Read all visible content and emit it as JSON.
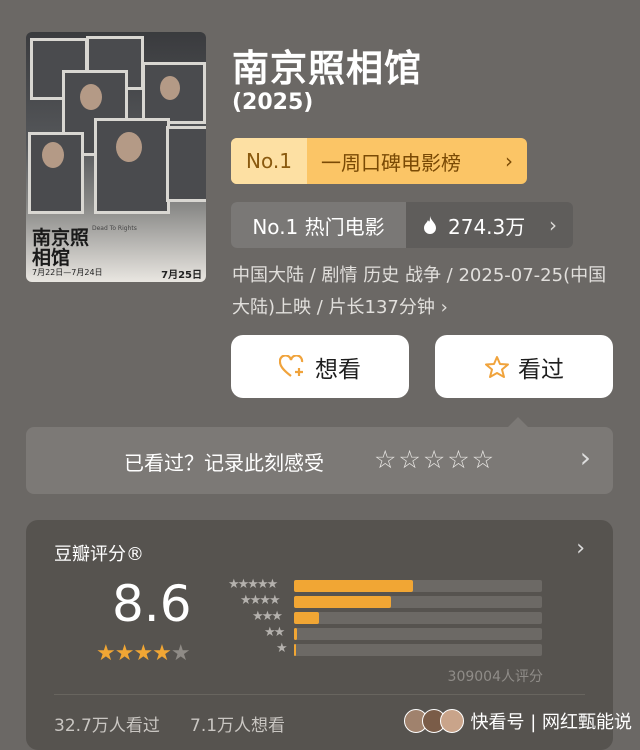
{
  "movie": {
    "title": "南京照相馆",
    "year": "(2025)",
    "poster": {
      "title": "南京照相馆",
      "subtitle": "Dead To Rights",
      "dates": "7月22日—7月24日",
      "release": "7月25日"
    }
  },
  "rank_weekly": {
    "label": "No.1",
    "text": "一周口碑电影榜",
    "chevron": "›"
  },
  "rank_hot": {
    "label": "No.1 热门电影",
    "heat": "274.3万",
    "chevron": "›"
  },
  "meta_text": "中国大陆 / 剧情 历史 战争 / 2025-07-25(中国大陆)上映 / 片长137分钟 ›",
  "actions": {
    "want_label": "想看",
    "watched_label": "看过"
  },
  "record": {
    "text": "已看过？记录此刻感受",
    "stars": "☆☆☆☆☆",
    "chevron": "›"
  },
  "rating": {
    "header": "豆瓣评分®",
    "chevron": "›",
    "score": "8.6",
    "stars_full": "★★★★",
    "stars_half": "★",
    "distribution": [
      {
        "stars": "★★★★★",
        "value": 0.48
      },
      {
        "stars": "★★★★",
        "value": 0.39
      },
      {
        "stars": "★★★",
        "value": 0.1
      },
      {
        "stars": "★★",
        "value": 0.012
      },
      {
        "stars": "★",
        "value": 0.008
      }
    ],
    "count": "309004人评分",
    "watched": "32.7万人看过",
    "wanted": "7.1万人想看"
  },
  "watermark": "快看号 | 网红甄能说",
  "colors": {
    "accent": "#f1a634",
    "rank_bg": "#fbc566",
    "button_bg": "#ffffff"
  },
  "icons": [
    "heart-plus-icon",
    "star-outline-icon",
    "flame-icon",
    "chevron-right-icon"
  ]
}
